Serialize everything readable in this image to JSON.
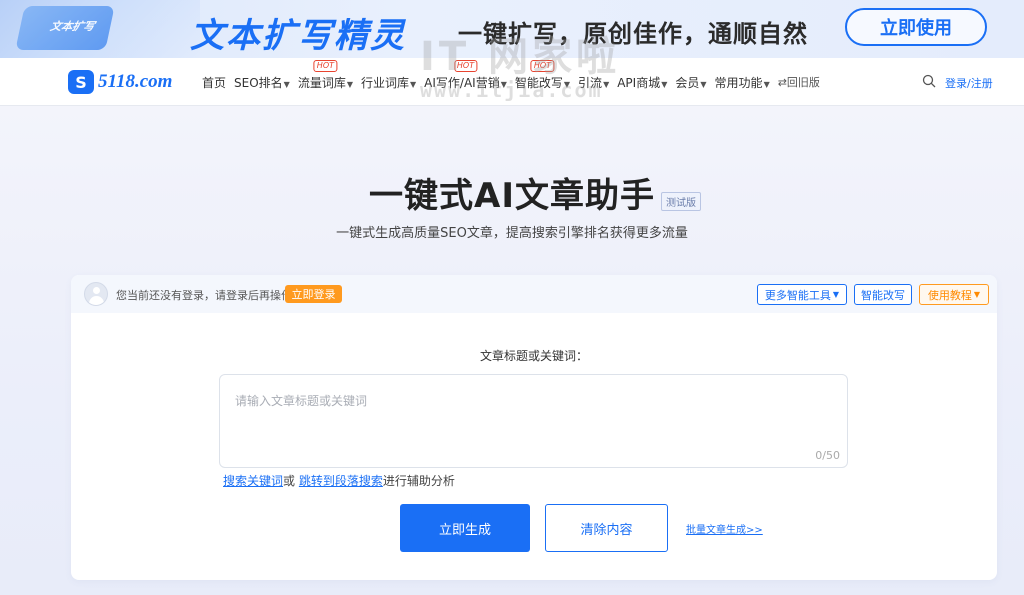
{
  "banner": {
    "title": "文本扩写精灵",
    "slogan": "一键扩写，原创佳作，通顺自然",
    "cta": "立即使用",
    "deco_text": "文本扩写",
    "watermark": "IT 网家啦",
    "watermark_url": "www.itjia.com"
  },
  "nav": {
    "logo_mark": "S",
    "logo_text": "5118.com",
    "items": [
      {
        "label": "首页",
        "dropdown": false,
        "hot": false
      },
      {
        "label": "SEO排名",
        "dropdown": true,
        "hot": false
      },
      {
        "label": "流量词库",
        "dropdown": true,
        "hot": true
      },
      {
        "label": "行业词库",
        "dropdown": true,
        "hot": false
      },
      {
        "label": "AI写作/AI营销",
        "dropdown": true,
        "hot": true
      },
      {
        "label": "智能改写",
        "dropdown": true,
        "hot": true
      },
      {
        "label": "引流",
        "dropdown": true,
        "hot": false
      },
      {
        "label": "API商城",
        "dropdown": true,
        "hot": false
      },
      {
        "label": "会员",
        "dropdown": true,
        "hot": false
      },
      {
        "label": "常用功能",
        "dropdown": true,
        "hot": false
      }
    ],
    "hot_badge": "HOT",
    "old_version": "⇄回旧版",
    "login": "登录/注册"
  },
  "hero": {
    "title": "一键式AI文章助手",
    "badge": "测试版",
    "subtitle": "一键式生成高质量SEO文章，提高搜索引擎排名获得更多流量"
  },
  "card": {
    "login_hint": "您当前还没有登录，请登录后再操作",
    "login_button": "立即登录",
    "tools": {
      "more": "更多智能工具",
      "rewrite": "智能改写",
      "guide": "使用教程"
    },
    "field_label": "文章标题或关键词：",
    "input_placeholder": "请输入文章标题或关键词",
    "input_value": "",
    "counter": "0/50",
    "helper": {
      "link1": "搜索关键词",
      "or": "或",
      "link2": "跳转到段落搜索",
      "suffix": "进行辅助分析"
    },
    "generate_button": "立即生成",
    "clear_button": "清除内容",
    "batch_link": "批量文章生成>>"
  },
  "colors": {
    "brand": "#1a6ff5",
    "accent": "#ff9a1f",
    "hot": "#e8432f"
  }
}
